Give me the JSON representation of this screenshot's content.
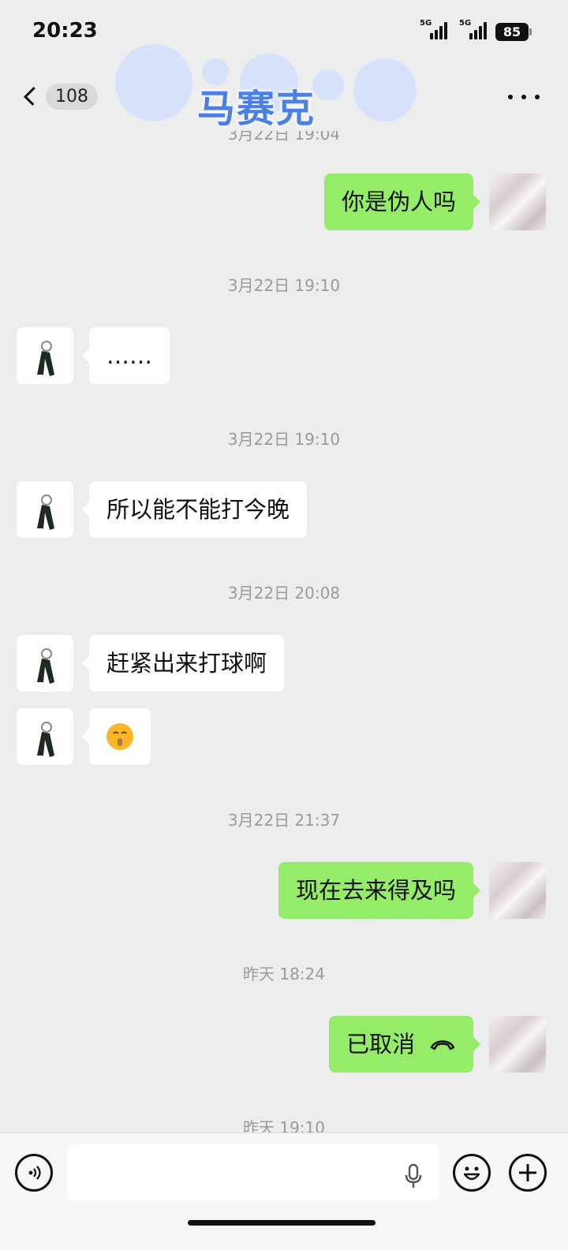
{
  "status_bar": {
    "time": "20:23",
    "signal1": "5G",
    "signal2": "5G",
    "battery": "85"
  },
  "header": {
    "unread_count": "108",
    "title": "马赛克",
    "more_icon": "more-icon"
  },
  "messages": [
    {
      "type": "timestamp",
      "text": "3月22日 19:04"
    },
    {
      "type": "sent",
      "text": "你是伪人吗"
    },
    {
      "type": "timestamp",
      "text": "3月22日 19:10"
    },
    {
      "type": "received",
      "text": "……"
    },
    {
      "type": "timestamp",
      "text": "3月22日 19:10"
    },
    {
      "type": "received",
      "text": "所以能不能打今晚"
    },
    {
      "type": "timestamp",
      "text": "3月22日 20:08"
    },
    {
      "type": "received",
      "text": "赶紧出来打球啊"
    },
    {
      "type": "received",
      "emoji": "shush-face-emoji"
    },
    {
      "type": "timestamp",
      "text": "3月22日 21:37"
    },
    {
      "type": "sent",
      "text": "现在去来得及吗"
    },
    {
      "type": "timestamp",
      "text": "昨天 18:24"
    },
    {
      "type": "sent",
      "text": "已取消",
      "icon": "hangup-icon"
    },
    {
      "type": "timestamp",
      "text": "昨天 19:10"
    }
  ],
  "input_bar": {
    "voice_icon": "voice-toggle-icon",
    "mic_icon": "mic-icon",
    "emoji_icon": "emoji-icon",
    "plus_icon": "plus-icon",
    "placeholder": ""
  }
}
